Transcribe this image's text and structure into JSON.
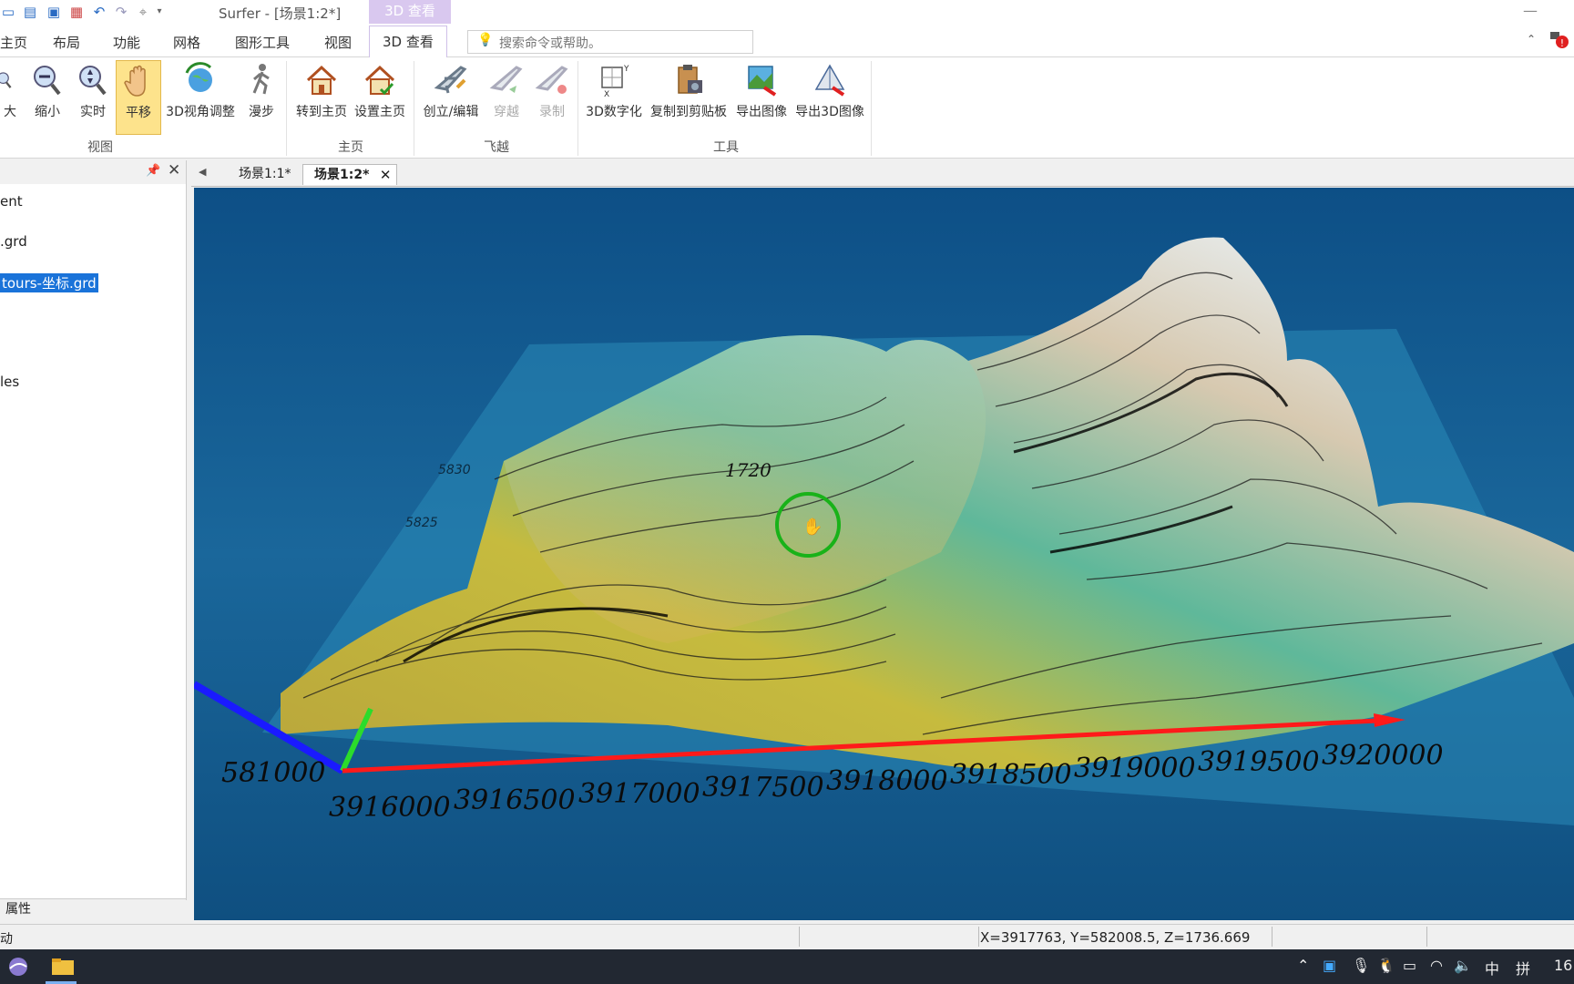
{
  "titlebar": {
    "app_title": "Surfer - [场景1:2*]",
    "context_tab": "3D 查看"
  },
  "tabs": [
    "主页",
    "布局",
    "功能",
    "网格",
    "图形工具",
    "视图",
    "3D 查看"
  ],
  "search": {
    "placeholder": "搜索命令或帮助。"
  },
  "ribbon": {
    "view_group": {
      "label": "视图",
      "buttons": [
        "大",
        "缩小",
        "实时",
        "平移",
        "3D视角调整",
        "漫步"
      ]
    },
    "home_group": {
      "label": "主页",
      "buttons": [
        "转到主页",
        "设置主页"
      ]
    },
    "fly_group": {
      "label": "飞越",
      "buttons": [
        "创立/编辑",
        "穿越",
        "录制"
      ]
    },
    "tools_group": {
      "label": "工具",
      "buttons": [
        "3D数字化",
        "复制到剪贴板",
        "导出图像",
        "导出3D图像"
      ]
    }
  },
  "left_panel": {
    "items": [
      "ent",
      ".grd",
      "tours-坐标.grd",
      "les"
    ],
    "bottom_tab": "属性"
  },
  "doc_tabs": [
    "场景1:1*",
    "场景1:2*"
  ],
  "viewport": {
    "x_ticks": [
      "3916000",
      "3916500",
      "3917000",
      "3917500",
      "3918000",
      "3918500",
      "3919000",
      "3919500",
      "3920000"
    ],
    "y_ticks": [
      "581000"
    ],
    "side_labels": [
      "5830",
      "5825"
    ],
    "contour_label": "1720"
  },
  "status": {
    "left": "动",
    "coords": "X=3917763, Y=582008.5, Z=1736.669"
  },
  "taskbar": {
    "ime": "中",
    "ime2": "拼",
    "clock": "16"
  },
  "colors": {
    "accent_context": "#d9c8ef",
    "pan_active": "#fde38c",
    "selection": "#1a73d9",
    "axis_x": "#ff1a1a",
    "axis_y": "#2bdc2b",
    "axis_z": "#1a1aff"
  }
}
